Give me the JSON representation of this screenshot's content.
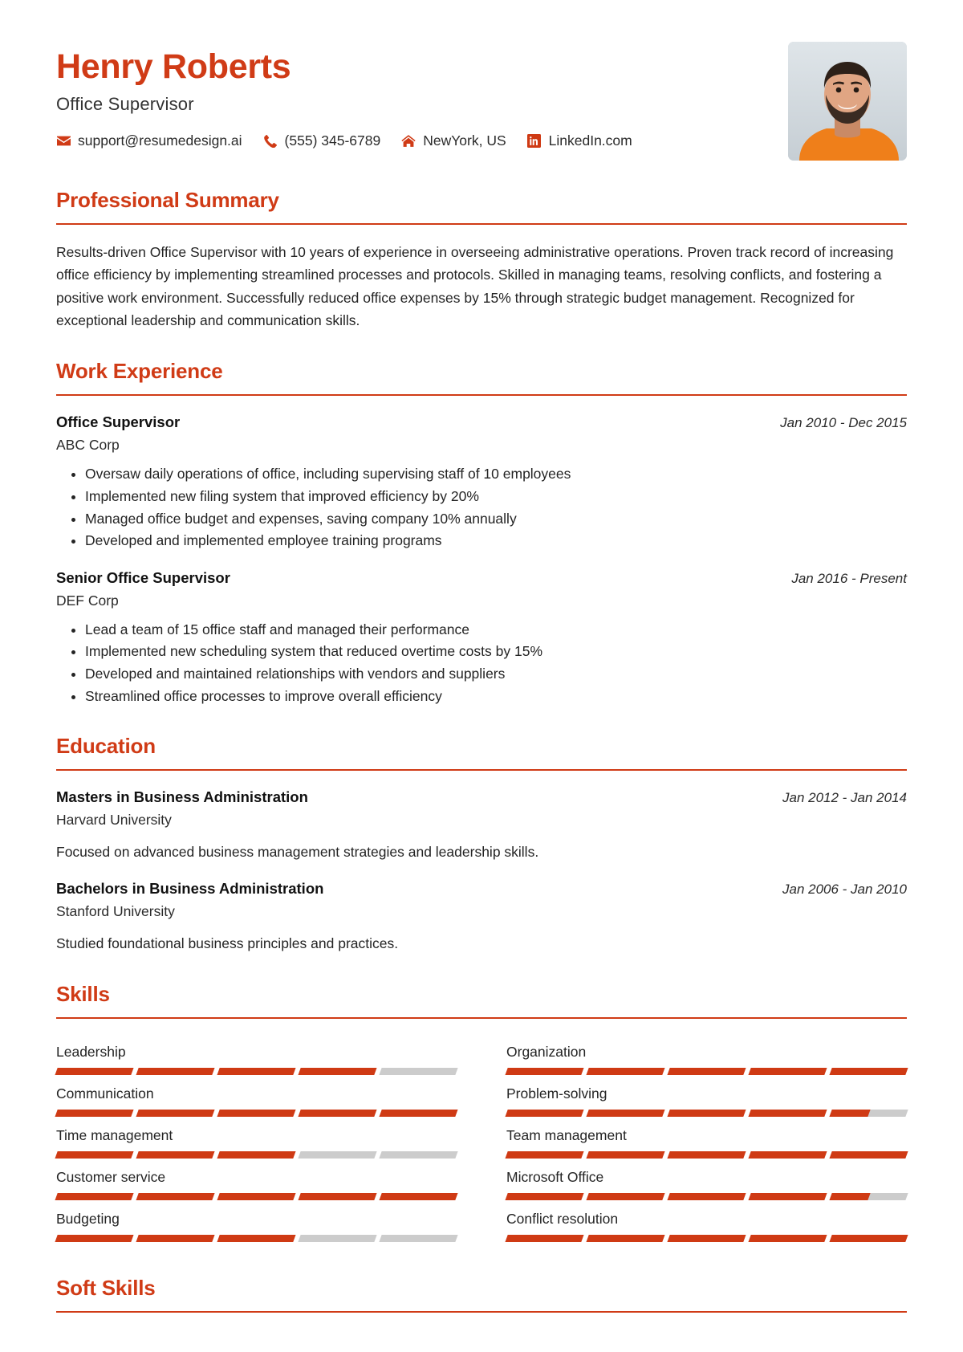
{
  "header": {
    "name": "Henry Roberts",
    "job_title": "Office Supervisor",
    "contacts": [
      {
        "icon": "envelope-icon",
        "text": "support@resumedesign.ai"
      },
      {
        "icon": "phone-icon",
        "text": "(555) 345-6789"
      },
      {
        "icon": "home-icon",
        "text": "NewYork, US"
      },
      {
        "icon": "linkedin-icon",
        "text": "LinkedIn.com"
      }
    ],
    "photo_alt": "profile-photo"
  },
  "sections": {
    "summary": {
      "title": "Professional Summary",
      "text": "Results-driven Office Supervisor with 10 years of experience in overseeing administrative operations. Proven track record of increasing office efficiency by implementing streamlined processes and protocols. Skilled in managing teams, resolving conflicts, and fostering a positive work environment. Successfully reduced office expenses by 15% through strategic budget management. Recognized for exceptional leadership and communication skills."
    },
    "work": {
      "title": "Work Experience",
      "entries": [
        {
          "title": "Office Supervisor",
          "org": "ABC Corp",
          "date": "Jan 2010 - Dec 2015",
          "bullets": [
            "Oversaw daily operations of office, including supervising staff of 10 employees",
            "Implemented new filing system that improved efficiency by 20%",
            "Managed office budget and expenses, saving company 10% annually",
            "Developed and implemented employee training programs"
          ]
        },
        {
          "title": "Senior Office Supervisor",
          "org": "DEF Corp",
          "date": "Jan 2016 - Present",
          "bullets": [
            "Lead a team of 15 office staff and managed their performance",
            "Implemented new scheduling system that reduced overtime costs by 15%",
            "Developed and maintained relationships with vendors and suppliers",
            "Streamlined office processes to improve overall efficiency"
          ]
        }
      ]
    },
    "education": {
      "title": "Education",
      "entries": [
        {
          "title": "Masters in Business Administration",
          "org": "Harvard University",
          "date": "Jan 2012 - Jan 2014",
          "desc": "Focused on advanced business management strategies and leadership skills."
        },
        {
          "title": "Bachelors in Business Administration",
          "org": "Stanford University",
          "date": "Jan 2006 - Jan 2010",
          "desc": "Studied foundational business principles and practices."
        }
      ]
    },
    "skills": {
      "title": "Skills",
      "segments": 5,
      "items": [
        {
          "label": "Leadership",
          "level": 4.0
        },
        {
          "label": "Organization",
          "level": 5.0
        },
        {
          "label": "Communication",
          "level": 5.0
        },
        {
          "label": "Problem-solving",
          "level": 4.5
        },
        {
          "label": "Time management",
          "level": 3.0
        },
        {
          "label": "Team management",
          "level": 5.0
        },
        {
          "label": "Customer service",
          "level": 5.0
        },
        {
          "label": "Microsoft Office",
          "level": 4.5
        },
        {
          "label": "Budgeting",
          "level": 3.0
        },
        {
          "label": "Conflict resolution",
          "level": 5.0
        }
      ]
    },
    "soft_skills": {
      "title": "Soft Skills"
    }
  },
  "colors": {
    "accent": "#d03b16",
    "bar_filled": "#cf3a14",
    "bar_empty": "#cccccc",
    "text": "#242424"
  }
}
